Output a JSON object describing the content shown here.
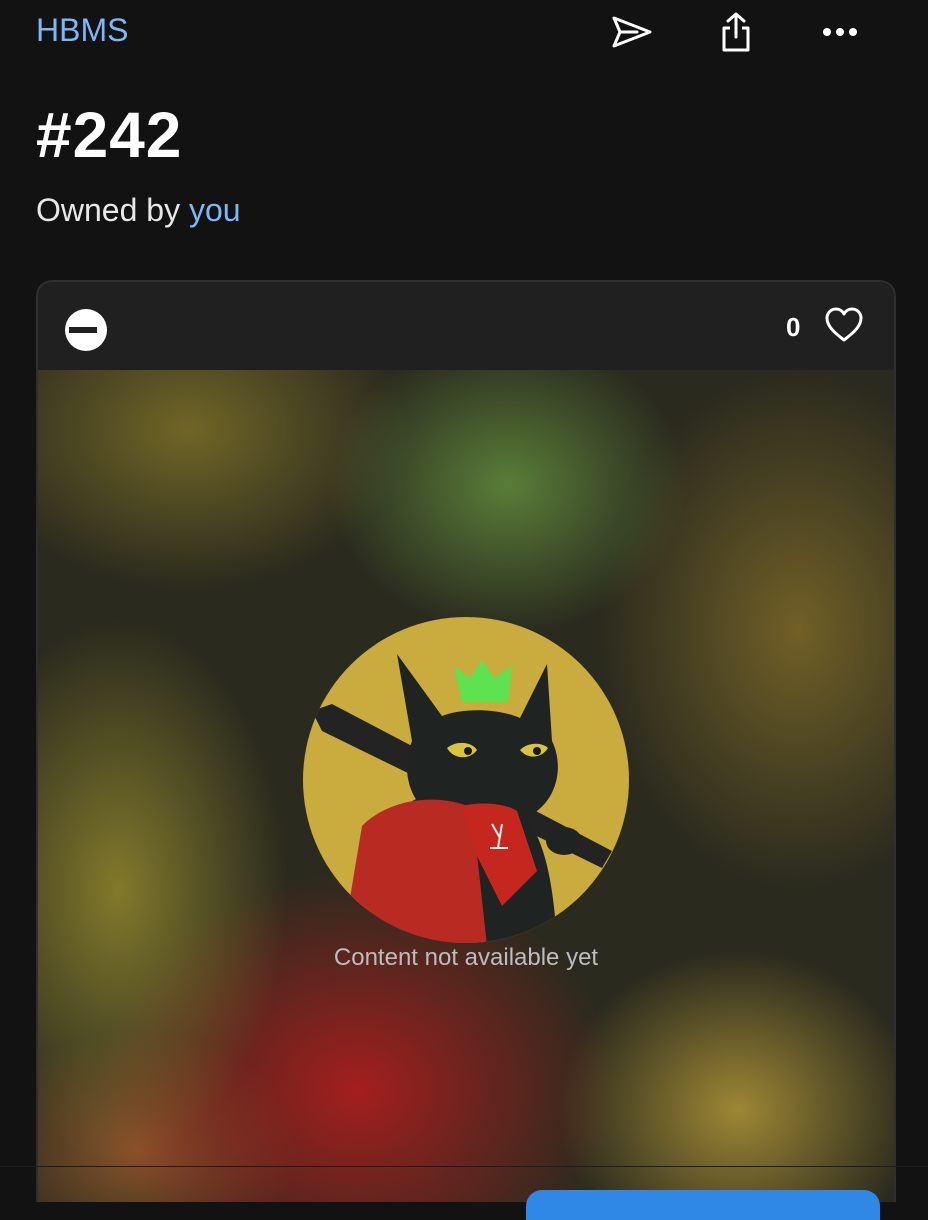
{
  "header": {
    "collection_name": "HBMS",
    "icons": [
      "send-icon",
      "share-icon",
      "more-icon"
    ]
  },
  "token": {
    "title": "#242",
    "owned_by_label": "Owned by",
    "owner": "you"
  },
  "card": {
    "chain_icon": "chain-badge-icon",
    "like_count": "0",
    "heart_icon": "heart-icon",
    "status_text": "Content not available yet"
  },
  "colors": {
    "background": "#121212",
    "link": "#7db7f5",
    "card": "#202020",
    "button": "#2f87e6"
  }
}
